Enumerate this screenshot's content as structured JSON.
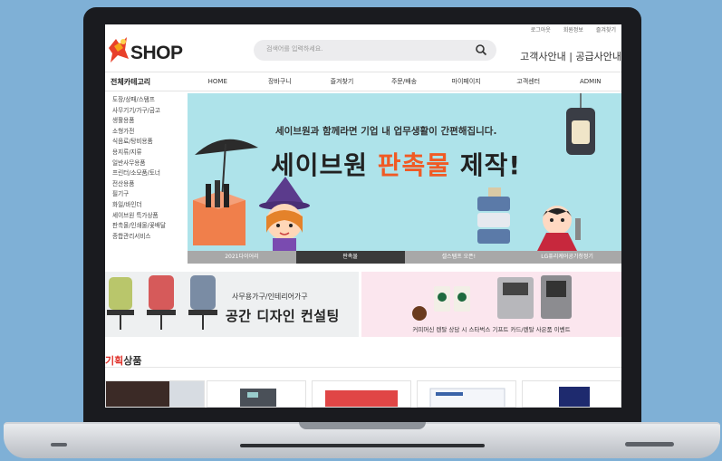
{
  "header": {
    "top_links": [
      "로그아웃",
      "회원정보",
      "즐겨찾기"
    ],
    "logo_text": "SHOP",
    "search_placeholder": "검색어를 입력하세요.",
    "service_text": "고객사안내 | 공급사안내"
  },
  "nav": {
    "category_header": "전체카테고리",
    "items": [
      "HOME",
      "장바구니",
      "즐겨찾기",
      "주문/배송",
      "마이페이지",
      "고객센터",
      "ADMIN"
    ]
  },
  "sidebar": {
    "items": [
      "도장/상패/스탬프",
      "사무기기/가구/금고",
      "생활용품",
      "소형가전",
      "식음료/탕비용품",
      "용지류/지류",
      "일반사무용품",
      "프린터/소모품/토너",
      "전산용품",
      "필기구",
      "화일/바인더",
      "세이브원 특가상품",
      "판촉물/인쇄물/꽃배달",
      "종합관리서비스"
    ]
  },
  "hero": {
    "subtitle": "세이브원과 함께라면 기업 내 업무생활이 간편해집니다.",
    "title_prefix": "세이브원 ",
    "title_highlight": "판촉물",
    "title_suffix": " 제작!",
    "tabs": [
      "2021다이어리",
      "판촉물",
      "셀스탬프 오픈!",
      "LG퓨리케어공기청정기"
    ],
    "active_tab": "판촉물"
  },
  "banners": {
    "office": {
      "line1": "사무용가구/인테리어가구",
      "line2": "공간 디자인 컨설팅"
    },
    "coffee": {
      "text": "커피머신 렌탈 상담 시 스타벅스 기프트 카드/렌탈 사은품 이벤트"
    }
  },
  "section": {
    "title_highlight": "기획",
    "title_rest": "상품"
  },
  "colors": {
    "hero_bg": "#aee3ea",
    "accent_orange": "#f05a24",
    "accent_red": "#e0322b",
    "bezel": "#1a1b1f"
  }
}
